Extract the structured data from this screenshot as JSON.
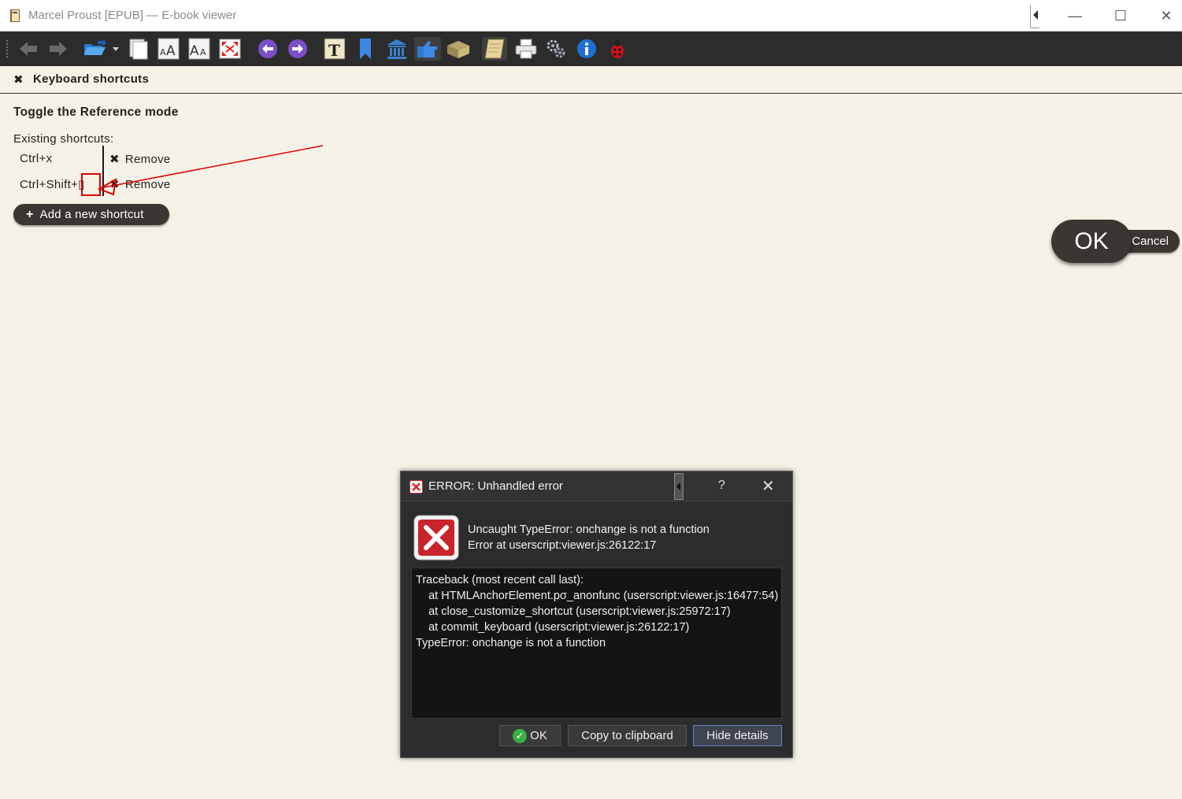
{
  "window": {
    "title": "Marcel Proust [EPUB] — E-book viewer",
    "minimize_glyph": "—",
    "maximize_glyph": "☐",
    "close_glyph": "✕"
  },
  "toolbar": {
    "icons": [
      "back-icon",
      "forward-icon",
      "open-book-icon",
      "copy-icon",
      "font-larger-icon",
      "font-smaller-icon",
      "fullscreen-icon",
      "previous-icon",
      "next-icon",
      "table-of-contents-icon",
      "bookmark-icon",
      "reference-mode-icon",
      "lookup-icon",
      "inspector-icon",
      "highlight-icon",
      "print-icon",
      "preferences-icon",
      "info-icon",
      "debug-icon"
    ]
  },
  "panel": {
    "close_glyph": "✖",
    "title": "Keyboard shortcuts",
    "action_title": "Toggle the Reference mode",
    "existing_label": "Existing shortcuts:",
    "shortcuts": [
      {
        "key": "Ctrl+x",
        "remove_label": "Remove"
      },
      {
        "key": "Ctrl+Shift+▯",
        "remove_label": "Remove"
      }
    ],
    "remove_glyph": "✖",
    "add_glyph": "+",
    "add_label": "Add a new shortcut",
    "ok_label": "OK",
    "cancel_label": "Cancel"
  },
  "dialog": {
    "title": "ERROR: Unhandled error",
    "help_glyph": "?",
    "close_glyph": "✕",
    "message_line1": "Uncaught TypeError: onchange is not a function",
    "message_line2": "Error at userscript:viewer.js:26122:17",
    "details": "Traceback (most recent call last):\n    at HTMLAnchorElement.pσ_anonfunc (userscript:viewer.js:16477:54)\n    at close_customize_shortcut (userscript:viewer.js:25972:17)\n    at commit_keyboard (userscript:viewer.js:26122:17)\nTypeError: onchange is not a function",
    "ok_label": "OK",
    "copy_label": "Copy to clipboard",
    "hide_label": "Hide details"
  },
  "colors": {
    "background": "#f4f1e6",
    "button_dark": "#3a3631",
    "annotation_red": "#dd0000"
  }
}
